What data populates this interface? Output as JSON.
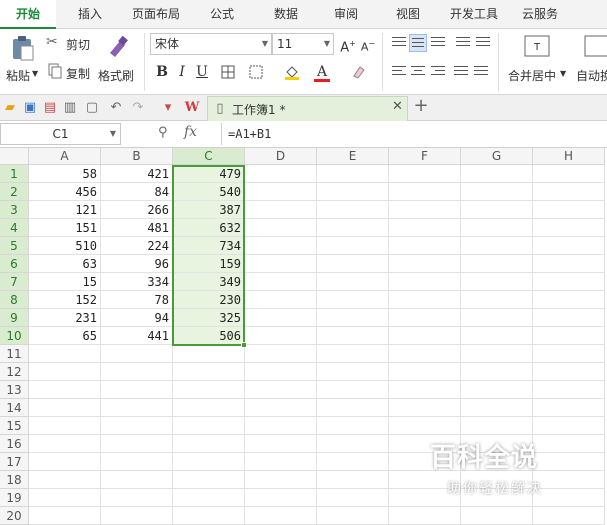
{
  "menu": {
    "tabs": [
      "开始",
      "插入",
      "页面布局",
      "公式",
      "数据",
      "审阅",
      "视图",
      "开发工具",
      "云服务"
    ],
    "active_index": 0
  },
  "ribbon": {
    "paste": "粘贴",
    "cut": "剪切",
    "copy": "复制",
    "format_painter": "格式刷",
    "font_name": "宋体",
    "font_size": "11",
    "bold": "B",
    "italic": "I",
    "underline": "U",
    "merge_center": "合并居中",
    "auto_wrap": "自动换"
  },
  "doc": {
    "tab_title": "工作簿1 *"
  },
  "formula_bar": {
    "cell_ref": "C1",
    "fx": "fx",
    "formula": "=A1+B1"
  },
  "sheet": {
    "columns": [
      "A",
      "B",
      "C",
      "D",
      "E",
      "F",
      "G",
      "H"
    ],
    "selected_column": "C",
    "row_count": 20,
    "data": [
      [
        "58",
        "421",
        "479"
      ],
      [
        "456",
        "84",
        "540"
      ],
      [
        "121",
        "266",
        "387"
      ],
      [
        "151",
        "481",
        "632"
      ],
      [
        "510",
        "224",
        "734"
      ],
      [
        "63",
        "96",
        "159"
      ],
      [
        "15",
        "334",
        "349"
      ],
      [
        "152",
        "78",
        "230"
      ],
      [
        "231",
        "94",
        "325"
      ],
      [
        "65",
        "441",
        "506"
      ]
    ]
  },
  "watermark": {
    "title": "百科全说",
    "subtitle": "助你轻松解决"
  },
  "colors": {
    "accent": "#1b8a3a",
    "selection": "#4a9a3a"
  }
}
